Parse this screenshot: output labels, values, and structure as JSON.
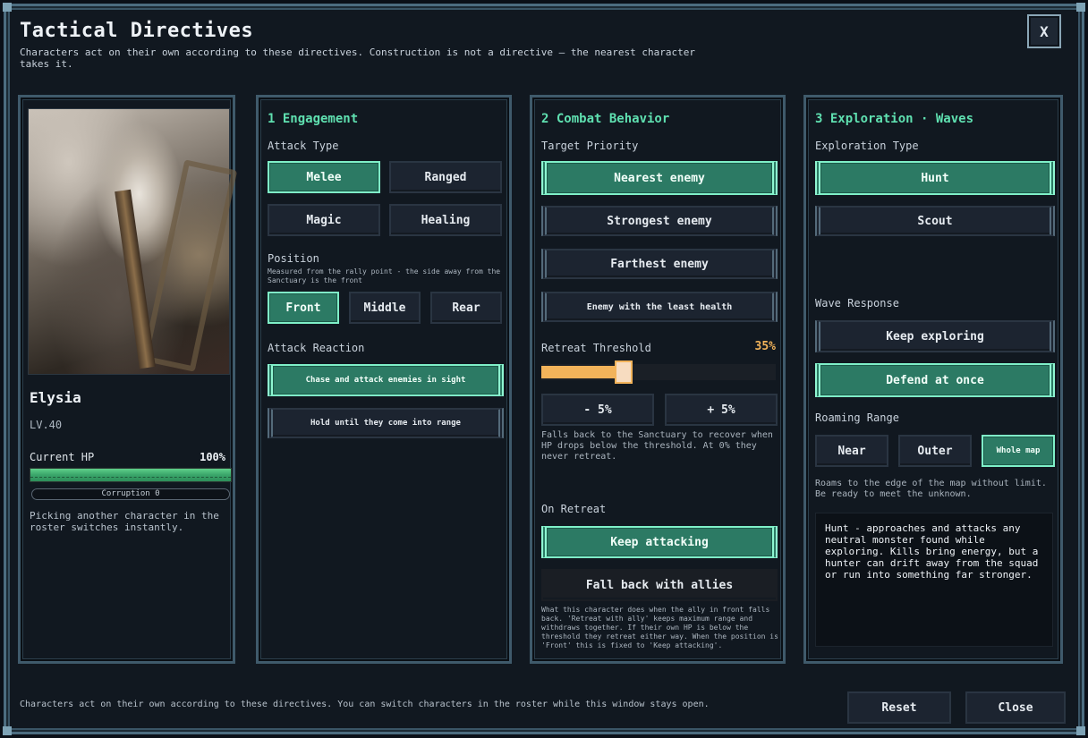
{
  "window": {
    "title": "Tactical Directives",
    "subtitle": "Characters act on their own according to these directives. Construction is not a directive — the nearest character takes it.",
    "close_icon": "X"
  },
  "character": {
    "name": "Elysia",
    "level": "LV.40",
    "hp_label": "Current HP",
    "hp_value": "100%",
    "hp_fraction": 1.0,
    "corruption": "Corruption 0",
    "hint": "Picking another character in the roster switches instantly."
  },
  "engagement": {
    "title": "1  Engagement",
    "attack_type_label": "Attack Type",
    "attack_types": [
      "Melee",
      "Ranged",
      "Magic",
      "Healing"
    ],
    "selected_attack_type": "Melee",
    "position_label": "Position",
    "position_note": "Measured from the rally point - the side away from the Sanctuary is the front",
    "positions": [
      "Front",
      "Middle",
      "Rear"
    ],
    "selected_position": "Front",
    "attack_reaction_label": "Attack Reaction",
    "reactions": [
      "Chase and attack enemies in sight",
      "Hold until they come into range"
    ],
    "selected_reaction": "Chase and attack enemies in sight"
  },
  "combat": {
    "title": "2  Combat Behavior",
    "target_priority_label": "Target Priority",
    "targets": [
      "Nearest enemy",
      "Strongest enemy",
      "Farthest enemy",
      "Enemy with the least health"
    ],
    "selected_target": "Nearest enemy",
    "retreat_label": "Retreat Threshold",
    "retreat_value": "35%",
    "retreat_fraction": 0.35,
    "minus_label": "- 5%",
    "plus_label": "+ 5%",
    "retreat_note": "Falls back to the Sanctuary to recover when HP drops below the threshold. At 0% they never retreat.",
    "on_retreat_label": "On Retreat",
    "on_retreat_options": [
      "Keep attacking",
      "Fall back with allies"
    ],
    "selected_on_retreat": "Keep attacking",
    "on_retreat_note": "What this character does when the ally in front falls back. 'Retreat with ally' keeps maximum range and withdraws together. If their own HP is below the threshold they retreat either way. When the position is 'Front' this is fixed to 'Keep attacking'."
  },
  "exploration": {
    "title": "3  Exploration · Waves",
    "type_label": "Exploration Type",
    "types": [
      "Hunt",
      "Scout"
    ],
    "selected_type": "Hunt",
    "wave_label": "Wave Response",
    "wave_options": [
      "Keep exploring",
      "Defend at once"
    ],
    "selected_wave": "Defend at once",
    "range_label": "Roaming Range",
    "ranges": [
      "Near",
      "Outer",
      "Whole map"
    ],
    "selected_range": "Whole map",
    "range_note": "Roams to the edge of the map without limit. Be ready to meet the unknown.",
    "description": "Hunt - approaches and attacks any neutral monster found while exploring. Kills bring energy, but a hunter can drift away from the squad or run into something far stronger."
  },
  "footer": {
    "text": "Characters act on their own according to these directives. You can switch characters in the roster while this window stays open.",
    "reset_label": "Reset",
    "close_label": "Close"
  },
  "colors": {
    "accent": "#5fe0b0",
    "selected": "#2c7a64",
    "threshold": "#f2b35a",
    "hp": "#3aa56a"
  }
}
